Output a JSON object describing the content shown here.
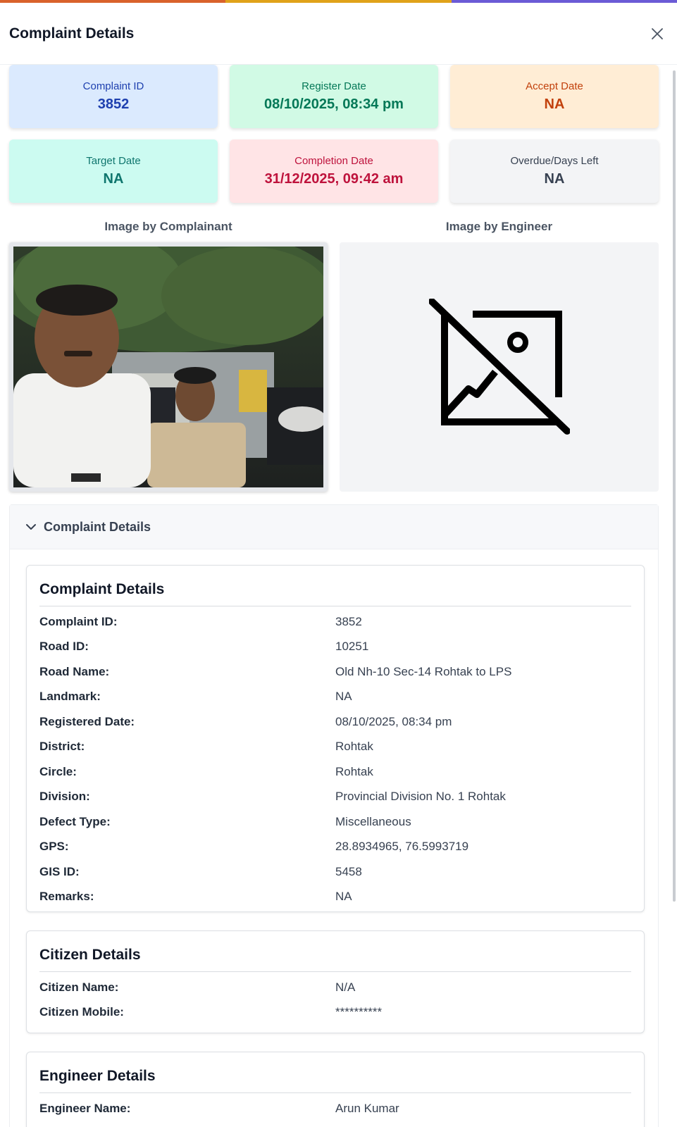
{
  "modal": {
    "title": "Complaint Details"
  },
  "stats": [
    {
      "label": "Complaint ID",
      "value": "3852",
      "bg": "#dbeafe",
      "label_color": "#1e40af",
      "value_color": "#1e40af"
    },
    {
      "label": "Register Date",
      "value": "08/10/2025, 08:34 pm",
      "bg": "#d1fae5",
      "label_color": "#047857",
      "value_color": "#047857"
    },
    {
      "label": "Accept Date",
      "value": "NA",
      "bg": "#ffedd5",
      "label_color": "#c2410c",
      "value_color": "#c2410c"
    },
    {
      "label": "Target Date",
      "value": "NA",
      "bg": "#ccfbf1",
      "label_color": "#0f766e",
      "value_color": "#0f766e"
    },
    {
      "label": "Completion Date",
      "value": "31/12/2025, 09:42 am",
      "bg": "#ffe4e6",
      "label_color": "#be123c",
      "value_color": "#be123c"
    },
    {
      "label": "Overdue/Days Left",
      "value": "NA",
      "bg": "#f3f4f6",
      "label_color": "#374151",
      "value_color": "#374151"
    }
  ],
  "images": {
    "complainant_title": "Image by Complainant",
    "engineer_title": "Image by Engineer",
    "engineer_icon": "image-off-icon"
  },
  "accordion": {
    "label": "Complaint Details",
    "icon": "chevron-down-icon"
  },
  "complaint_details": {
    "heading": "Complaint Details",
    "rows": [
      {
        "k": "Complaint ID:",
        "v": "3852"
      },
      {
        "k": "Road ID:",
        "v": "10251"
      },
      {
        "k": "Road Name:",
        "v": "Old Nh-10 Sec-14 Rohtak to LPS"
      },
      {
        "k": "Landmark:",
        "v": "NA"
      },
      {
        "k": "Registered Date:",
        "v": "08/10/2025, 08:34 pm"
      },
      {
        "k": "District:",
        "v": "Rohtak"
      },
      {
        "k": "Circle:",
        "v": "Rohtak"
      },
      {
        "k": "Division:",
        "v": "Provincial Division No. 1 Rohtak"
      },
      {
        "k": "Defect Type:",
        "v": "Miscellaneous"
      },
      {
        "k": "GPS:",
        "v": "28.8934965, 76.5993719"
      },
      {
        "k": "GIS ID:",
        "v": "5458"
      },
      {
        "k": "Remarks:",
        "v": "NA"
      }
    ]
  },
  "citizen_details": {
    "heading": "Citizen Details",
    "rows": [
      {
        "k": "Citizen Name:",
        "v": "N/A"
      },
      {
        "k": "Citizen Mobile:",
        "v": "**********"
      }
    ]
  },
  "engineer_details": {
    "heading": "Engineer Details",
    "rows": [
      {
        "k": "Engineer Name:",
        "v": "Arun Kumar"
      }
    ]
  },
  "colors": {
    "strip": [
      "#d9622b",
      "#e0a21a",
      "#6b5bd6"
    ]
  }
}
